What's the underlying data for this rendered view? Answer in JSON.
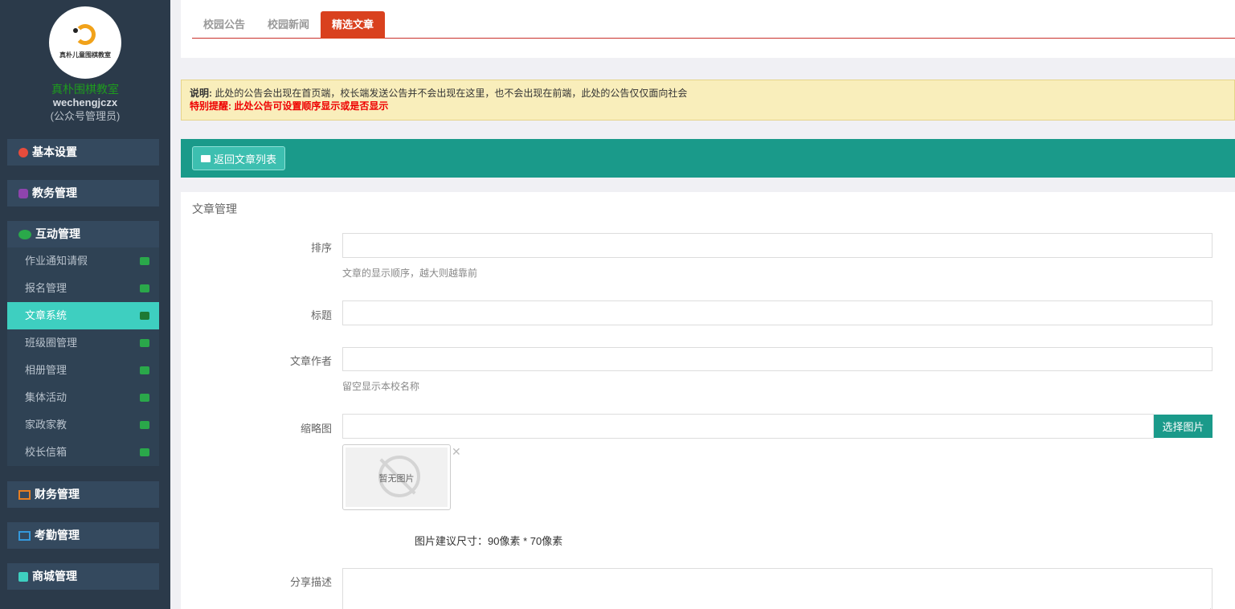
{
  "sidebar": {
    "logo_text": "真朴儿童围棋教室",
    "school_name": "真朴围棋教室",
    "username": "wechengjczx",
    "role": "(公众号管理员)",
    "groups": [
      {
        "label": "基本设置",
        "icon": "gear-icon",
        "color": "#e74c3c"
      },
      {
        "label": "教务管理",
        "icon": "database-icon",
        "color": "#8e44ad"
      },
      {
        "label": "互动管理",
        "icon": "wechat-icon",
        "color": "#2aa84a"
      },
      {
        "label": "财务管理",
        "icon": "money-icon",
        "color": "#e67e22"
      },
      {
        "label": "考勤管理",
        "icon": "card-icon",
        "color": "#3498db"
      },
      {
        "label": "商城管理",
        "icon": "cart-icon",
        "color": "#3ecfc0"
      }
    ],
    "interaction_items": [
      {
        "label": "作业通知请假",
        "icon": "bullhorn-icon"
      },
      {
        "label": "报名管理",
        "icon": "comments-icon"
      },
      {
        "label": "文章系统",
        "icon": "desktop-icon",
        "active": true
      },
      {
        "label": "班级圈管理",
        "icon": "wechat-icon"
      },
      {
        "label": "相册管理",
        "icon": "camera-icon"
      },
      {
        "label": "集体活动",
        "icon": "trophy-icon"
      },
      {
        "label": "家政家教",
        "icon": "coffee-icon"
      },
      {
        "label": "校长信箱",
        "icon": "comments-icon"
      }
    ]
  },
  "tabs": [
    {
      "label": "校园公告"
    },
    {
      "label": "校园新闻"
    },
    {
      "label": "精选文章",
      "active": true
    }
  ],
  "notice": {
    "prefix": "说明:",
    "text": "此处的公告会出现在首页端，校长端发送公告并不会出现在这里，也不会出现在前端，此处的公告仅仅面向社会",
    "warning": "特别提醒: 此处公告可设置顺序显示或是否显示"
  },
  "back_button": "返回文章列表",
  "form": {
    "panel_title": "文章管理",
    "order_label": "排序",
    "order_help": "文章的显示顺序，越大则越靠前",
    "title_label": "标题",
    "author_label": "文章作者",
    "author_help": "留空显示本校名称",
    "thumb_label": "缩略图",
    "pick_button": "选择图片",
    "no_image_text": "暂无图片",
    "close_symbol": "✕",
    "size_tip": "图片建议尺寸：90像素 * 70像素",
    "share_label": "分享描述"
  }
}
